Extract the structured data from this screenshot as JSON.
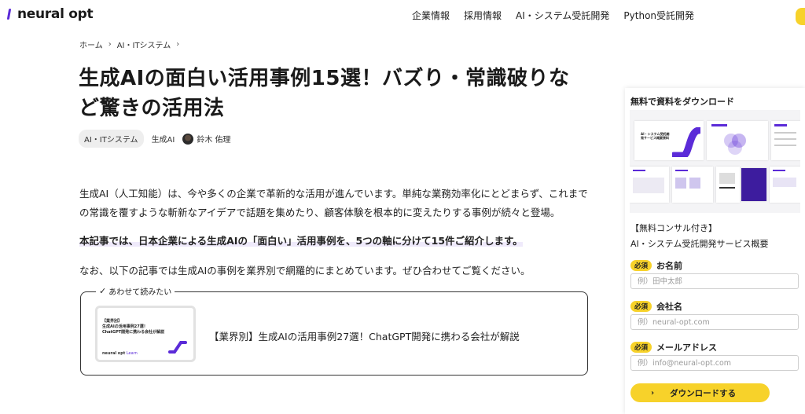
{
  "header": {
    "logo_text": "neural opt",
    "nav": [
      "企業情報",
      "採用情報",
      "AI・システム受託開発",
      "Python受託開発"
    ]
  },
  "breadcrumb": [
    "ホーム",
    "AI・ITシステム"
  ],
  "article": {
    "title": "生成AIの面白い活用事例15選！バズり・常識破りなど驚きの活用法",
    "tag_pill": "AI・ITシステム",
    "tag_plain": "生成AI",
    "author": "鈴木 佑理",
    "p1": "生成AI（人工知能）は、今や多くの企業で革新的な活用が進んでいます。単純な業務効率化にとどまらず、これまでの常識を覆すような斬新なアイデアで話題を集めたり、顧客体験を根本的に変えたりする事例が続々と登場。",
    "p2": "本記事では、日本企業による生成AIの「面白い」活用事例を、5つの軸に分けて15件ご紹介します。",
    "p3": "なお、以下の記事では生成AIの事例を業界別で網羅的にまとめています。ぜひ合わせてご覧ください。"
  },
  "related": {
    "label": "あわせて読みたい",
    "thumb_lines": [
      "【業界別】",
      "生成AIの活用事例27選！",
      "ChatGPT開発に携わる会社が解説"
    ],
    "thumb_brand": "neural opt",
    "thumb_brand_suffix": "Learn",
    "text": "【業界別】生成AIの活用事例27選！ChatGPT開発に携わる会社が解説"
  },
  "sidebar": {
    "title": "無料で資料をダウンロード",
    "slide_title": "AI・システム受託開発サービス概要資料",
    "line1": "【無料コンサル付き】",
    "line2": "AI・システム受託開発サービス概要",
    "required": "必須",
    "fields": [
      {
        "label": "お名前",
        "placeholder": "例）田中太郎"
      },
      {
        "label": "会社名",
        "placeholder": "例）neural-opt.com"
      },
      {
        "label": "メールアドレス",
        "placeholder": "例）info@neural-opt.com"
      }
    ],
    "button": "ダウンロードする"
  },
  "colors": {
    "accent": "#f7d22a",
    "brand": "#5b2bd8"
  }
}
